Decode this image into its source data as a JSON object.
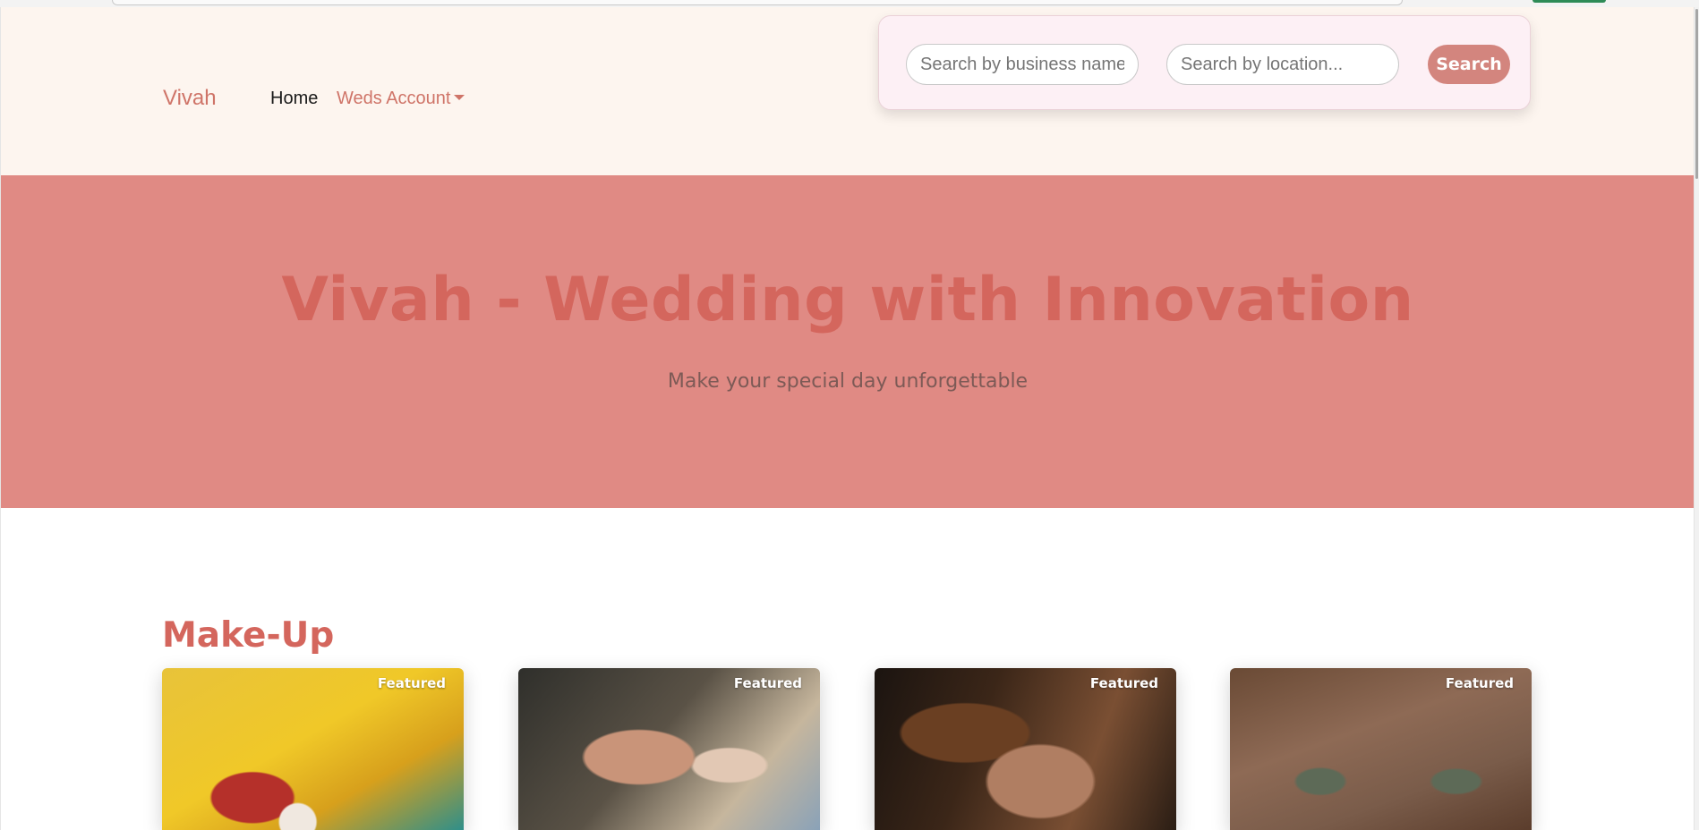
{
  "header": {
    "brand": "Vivah",
    "nav": [
      {
        "label": "Home"
      },
      {
        "label": "Weds Account"
      }
    ]
  },
  "search": {
    "business_placeholder": "Search by business name...",
    "location_placeholder": "Search by location...",
    "button_label": "Search"
  },
  "hero": {
    "title": "Vivah - Wedding with Innovation",
    "subtitle": "Make your special day unforgettable"
  },
  "section": {
    "title": "Make-Up",
    "cards": [
      {
        "badge": "Featured",
        "image": "child-face-paint-photo"
      },
      {
        "badge": "Featured",
        "image": "makeup-application-photo"
      },
      {
        "badge": "Featured",
        "image": "curly-hair-portrait-photo"
      },
      {
        "badge": "Featured",
        "image": "bridal-eye-makeup-photo"
      }
    ]
  },
  "colors": {
    "accent": "#cf7468",
    "hero_bg": "#e08a84",
    "header_bg": "#fdf5ef",
    "button_bg": "#d3857e"
  }
}
